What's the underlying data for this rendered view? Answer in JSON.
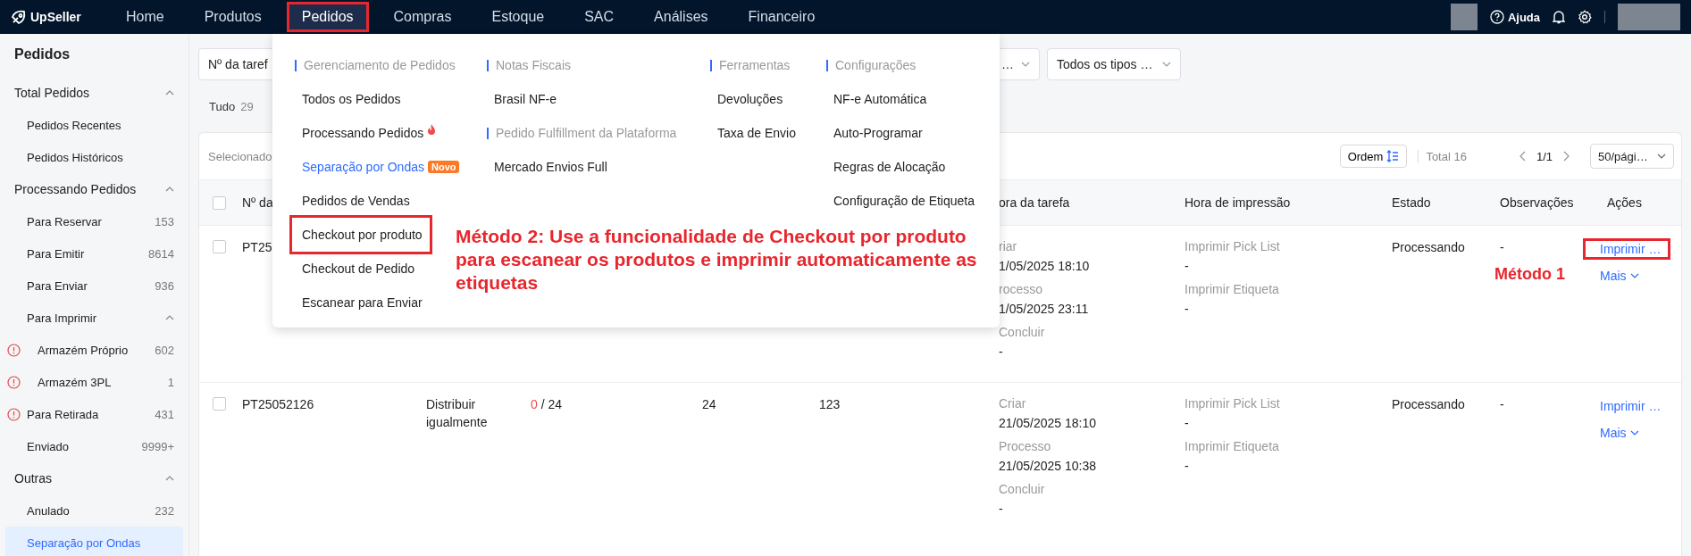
{
  "topbar": {
    "logo": "UpSeller",
    "help": "Ajuda",
    "nav": [
      {
        "label": "Home",
        "selected": false,
        "annotated": false
      },
      {
        "label": "Produtos",
        "selected": false,
        "annotated": false
      },
      {
        "label": "Pedidos",
        "selected": true,
        "annotated": true
      },
      {
        "label": "Compras",
        "selected": false,
        "annotated": false
      },
      {
        "label": "Estoque",
        "selected": false,
        "annotated": false
      },
      {
        "label": "SAC",
        "selected": false,
        "annotated": false
      },
      {
        "label": "Análises",
        "selected": false,
        "annotated": false
      },
      {
        "label": "Financeiro",
        "selected": false,
        "annotated": false
      }
    ]
  },
  "sidebar": {
    "title": "Pedidos",
    "groups": [
      {
        "label": "Total Pedidos",
        "expanded": true,
        "children": [
          {
            "label": "Pedidos Recentes",
            "selected": false
          },
          {
            "label": "Pedidos Históricos",
            "selected": false
          }
        ]
      },
      {
        "label": "Processando Pedidos",
        "expanded": true,
        "children": [
          {
            "label": "Para Reservar",
            "count": "153",
            "selected": false
          },
          {
            "label": "Para Emitir",
            "count": "8614",
            "selected": false
          },
          {
            "label": "Para Enviar",
            "count": "936",
            "selected": false
          },
          {
            "label": "Para Imprimir",
            "expanded": true,
            "selected": false,
            "children": [
              {
                "label": "Armazém Próprio",
                "count": "602",
                "alert": true,
                "selected": false
              },
              {
                "label": "Armazém 3PL",
                "count": "1",
                "alert": true,
                "selected": false
              }
            ]
          },
          {
            "label": "Para Retirada",
            "count": "431",
            "alert": true,
            "selected": false
          },
          {
            "label": "Enviado",
            "count": "9999+",
            "selected": false
          }
        ]
      },
      {
        "label": "Outras",
        "expanded": true,
        "children": [
          {
            "label": "Anulado",
            "count": "232",
            "selected": false
          },
          {
            "label": "Separação por Ondas",
            "selected": true
          }
        ]
      }
    ]
  },
  "filters": [
    {
      "value": "Nº da taref"
    },
    {
      "value": "…"
    },
    {
      "value": "Todos os tipos …"
    }
  ],
  "tabs": [
    {
      "label": "Tudo",
      "count": "29"
    }
  ],
  "toolbar": {
    "selected_label": "Selecionado",
    "order_button": "Ordem",
    "total": "Total 16",
    "page": "1/1",
    "page_size": "50/pági…"
  },
  "table": {
    "header_checked": false,
    "columns": [
      "Nº da",
      "ora da tarefa",
      "Hora de impressão",
      "Estado",
      "Observações",
      "Ações"
    ],
    "rows": [
      {
        "checked": false,
        "task_no": "PT25",
        "times": [
          {
            "label": "riar",
            "value": "1/05/2025 18:10"
          },
          {
            "label": "rocesso",
            "value": "1/05/2025 23:11"
          },
          {
            "label": "Concluir",
            "value": "-"
          }
        ],
        "prints": [
          {
            "label": "Imprimir Pick List",
            "value": "-"
          },
          {
            "label": "Imprimir Etiqueta",
            "value": "-"
          }
        ],
        "state": "Processando",
        "notes": "-",
        "annotation": "Método 1",
        "actions": [
          {
            "label": "Imprimir …",
            "kind": "link",
            "annotated": true
          },
          {
            "label": "Mais",
            "kind": "menu",
            "annotated": false
          }
        ]
      },
      {
        "checked": false,
        "task_no": "PT25052126",
        "distribution": "Distribuir igualmente",
        "progress_done": "0",
        "progress_rest": "/ 24",
        "quantity": "24",
        "count": "123",
        "times": [
          {
            "label": "Criar",
            "value": "21/05/2025 18:10"
          },
          {
            "label": "Processo",
            "value": "21/05/2025 10:38"
          },
          {
            "label": "Concluir",
            "value": "-"
          }
        ],
        "prints": [
          {
            "label": "Imprimir Pick List",
            "value": "-"
          },
          {
            "label": "Imprimir Etiqueta",
            "value": "-"
          }
        ],
        "state": "Processando",
        "notes": "-",
        "actions": [
          {
            "label": "Imprimir …",
            "kind": "link",
            "annotated": false
          },
          {
            "label": "Mais",
            "kind": "menu",
            "annotated": false
          }
        ]
      }
    ]
  },
  "menu": {
    "annotation": "Método 2: Use a funcionalidade de Checkout por produto para escanear os produtos e imprimir automaticamente as etiquetas",
    "columns": [
      {
        "groups": [
          {
            "title": "Gerenciamento de Pedidos",
            "items": [
              {
                "label": "Todos os Pedidos",
                "selected": false,
                "annotated": false
              },
              {
                "label": "Processando Pedidos",
                "selected": false,
                "annotated": false,
                "hot": true
              },
              {
                "label": "Separação por Ondas",
                "selected": true,
                "annotated": false,
                "badge": "Novo"
              },
              {
                "label": "Pedidos de Vendas",
                "selected": false,
                "annotated": false
              },
              {
                "label": "Checkout por produto",
                "selected": false,
                "annotated": true
              },
              {
                "label": "Checkout de Pedido",
                "selected": false,
                "annotated": false
              },
              {
                "label": "Escanear para Enviar",
                "selected": false,
                "annotated": false
              }
            ]
          }
        ]
      },
      {
        "groups": [
          {
            "title": "Notas Fiscais",
            "items": [
              {
                "label": "Brasil NF-e",
                "selected": false,
                "annotated": false
              }
            ]
          },
          {
            "title": "Pedido Fulfillment da Plataforma",
            "items": [
              {
                "label": "Mercado Envios Full",
                "selected": false,
                "annotated": false
              }
            ]
          }
        ]
      },
      {
        "groups": [
          {
            "title": "Ferramentas",
            "items": [
              {
                "label": "Devoluções",
                "selected": false,
                "annotated": false
              },
              {
                "label": "Taxa de Envio",
                "selected": false,
                "annotated": false
              }
            ]
          }
        ]
      },
      {
        "groups": [
          {
            "title": "Configurações",
            "items": [
              {
                "label": "NF-e Automática",
                "selected": false,
                "annotated": false
              },
              {
                "label": "Auto-Programar",
                "selected": false,
                "annotated": false
              },
              {
                "label": "Regras de Alocação",
                "selected": false,
                "annotated": false
              },
              {
                "label": "Configuração de Etiqueta",
                "selected": false,
                "annotated": false
              }
            ]
          }
        ]
      }
    ]
  }
}
